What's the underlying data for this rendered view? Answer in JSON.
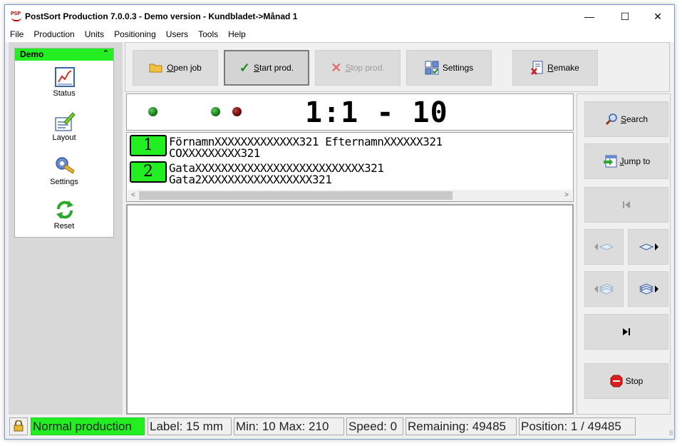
{
  "window": {
    "app_icon_text": "PSP",
    "title": "PostSort Production 7.0.0.3  -  Demo version  -  Kundbladet->Månad 1",
    "minimize": "—",
    "maximize": "☐",
    "close": "✕"
  },
  "menu": [
    "File",
    "Production",
    "Units",
    "Positioning",
    "Users",
    "Tools",
    "Help"
  ],
  "sidebar": {
    "header": "Demo",
    "collapse_glyph": "⌃",
    "items": [
      {
        "label": "Status",
        "icon": "chart-icon"
      },
      {
        "label": "Layout",
        "icon": "layout-icon"
      },
      {
        "label": "Settings",
        "icon": "settings-icon"
      },
      {
        "label": "Reset",
        "icon": "reset-icon"
      }
    ]
  },
  "toolbar": {
    "open_job": {
      "key": "O",
      "rest": "pen job"
    },
    "start_prod": {
      "key": "S",
      "rest": "tart prod."
    },
    "stop_prod": {
      "key": "S",
      "rest": "top prod."
    },
    "settings": "Settings",
    "remake": {
      "key": "R",
      "rest": "emake"
    }
  },
  "counter": {
    "text": "1:1 - 10"
  },
  "preview": {
    "rows": [
      {
        "num": "1",
        "lines": [
          "FörnamnXXXXXXXXXXXXX321 EfternamnXXXXXX321",
          "COXXXXXXXXX321"
        ]
      },
      {
        "num": "2",
        "lines": [
          "GataXXXXXXXXXXXXXXXXXXXXXXXXXX321",
          "Gata2XXXXXXXXXXXXXXXXX321"
        ]
      }
    ],
    "scroll_left": "<",
    "scroll_right": ">"
  },
  "nav": {
    "search": {
      "key": "S",
      "rest": "earch"
    },
    "jump_to": {
      "key": "J",
      "rest": "ump to"
    },
    "stop": "Stop"
  },
  "status": {
    "mode": "Normal production",
    "label": "Label: 15 mm",
    "minmax": "Min: 10  Max: 210",
    "speed": "Speed: 0",
    "remaining": "Remaining: 49485",
    "position": "Position: 1 / 49485"
  },
  "colors": {
    "accent_green": "#22ee22",
    "led_green": "#0a6a0a",
    "led_red": "#5a0000"
  }
}
